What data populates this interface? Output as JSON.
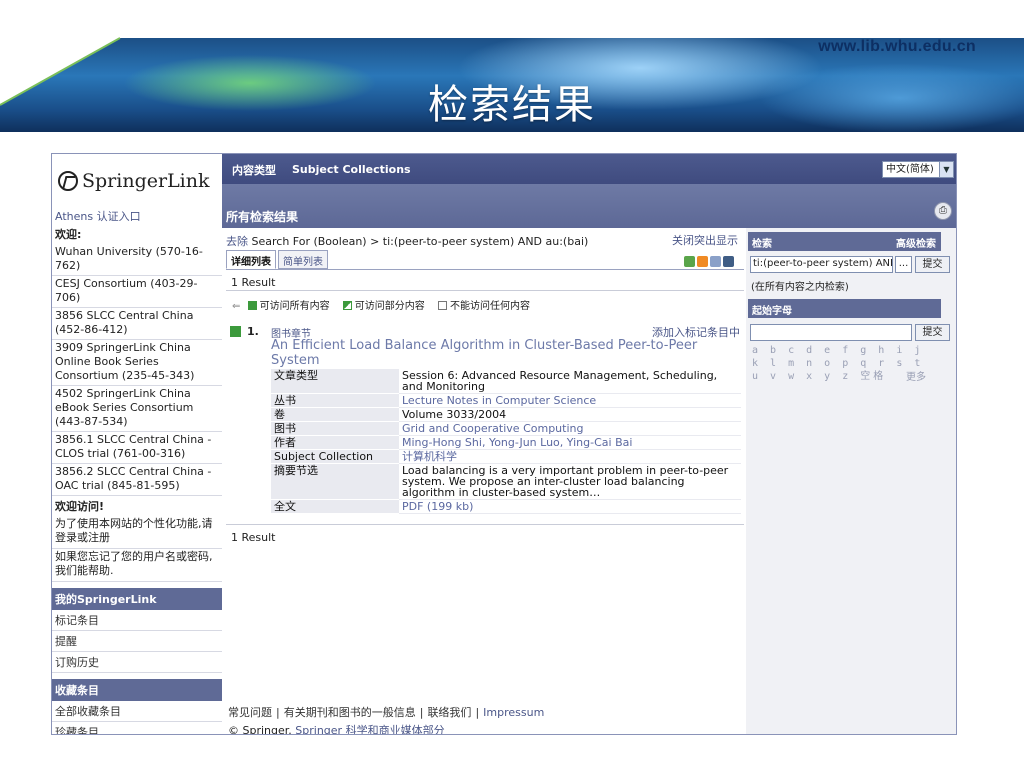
{
  "slide": {
    "url": "www.lib.whu.edu.cn",
    "title": "检索结果"
  },
  "topbar": {
    "content_type_label": "内容类型",
    "subject_collections_label": "Subject Collections",
    "language_select": "中文(简体)"
  },
  "header": {
    "all_results_title": "所有检索结果"
  },
  "sidebar": {
    "logo_text": "SpringerLink",
    "athens_login": "Athens 认证入口",
    "welcome_label": "欢迎:",
    "institutions": [
      "Wuhan University (570-16-762)",
      "CESJ Consortium (403-29-706)",
      "3856 SLCC Central China (452-86-412)",
      "3909 SpringerLink China Online Book Series Consortium (235-45-343)",
      "4502 SpringerLink China eBook Series Consortium (443-87-534)",
      "3856.1 SLCC Central China - CLOS trial (761-00-316)",
      "3856.2 SLCC Central China - OAC trial (845-81-595)"
    ],
    "welcome_visit": "欢迎访问!",
    "personalize_note": "为了使用本网站的个性化功能,请登录或注册",
    "forgot_note": "如果您忘记了您的用户名或密码,我们能帮助.",
    "my_springerlink_heading": "我的SpringerLink",
    "my_links": [
      "标记条目",
      "提醒",
      "订购历史"
    ],
    "favorites_heading": "收藏条目",
    "favorite_links": [
      "全部收藏条目",
      "珍藏条目"
    ]
  },
  "search_summary": {
    "remove_label": "去除",
    "query_text": "Search For (Boolean) > ti:(peer-to-peer system) AND au:(bai)",
    "close_highlight": "关闭突出显示"
  },
  "tabs": [
    {
      "label": "详细列表",
      "active": true
    },
    {
      "label": "简单列表",
      "active": false
    }
  ],
  "result_count_text": "1 Result",
  "legend": {
    "all_access": "可访问所有内容",
    "partial_access": "可访问部分内容",
    "no_access": "不能访问任何内容"
  },
  "result": {
    "number": "1.",
    "item_type": "图书章节",
    "add_to_marked": "添加入标记条目中",
    "title": "An Efficient Load Balance Algorithm in Cluster-Based Peer-to-Peer System",
    "fields": [
      {
        "key": "文章类型",
        "value": "Session 6: Advanced Resource Management, Scheduling, and Monitoring",
        "link": false
      },
      {
        "key": "丛书",
        "value": "Lecture Notes in Computer Science",
        "link": true
      },
      {
        "key": "卷",
        "value": "Volume 3033/2004",
        "link": false
      },
      {
        "key": "图书",
        "value": "Grid and Cooperative Computing",
        "link": true
      },
      {
        "key": "Subject Collection",
        "value": "计算机科学",
        "link": true
      },
      {
        "key": "摘要节选",
        "value": "Load balancing is a very important problem in peer-to-peer system. We propose an inter-cluster load balancing algorithm in cluster-based system…",
        "link": false
      },
      {
        "key": "全文",
        "value": "PDF (199 kb)",
        "link": true
      }
    ],
    "authors_key": "作者",
    "authors": [
      "Ming-Hong Shi",
      "Yong-Jun Luo",
      "Ying-Cai Bai"
    ]
  },
  "right_panel": {
    "search_heading": "检索",
    "advanced_search": "高级检索",
    "search_input_value": "ti:(peer-to-peer system) AND",
    "dots_button": "...",
    "submit_label": "提交",
    "scope_note": "(在所有内容之内检索)",
    "starting_letter_heading": "起始字母",
    "letters": "a b c d e f g h i j k l m n o p q r s t u v w x y z 空格",
    "more": "更多"
  },
  "footer": {
    "links": [
      "常见问题",
      "有关期刊和图书的一般信息",
      "联络我们",
      "Impressum"
    ],
    "copyright_prefix": "© Springer.",
    "copyright_tail": "Springer 科学和商业媒体部分"
  }
}
